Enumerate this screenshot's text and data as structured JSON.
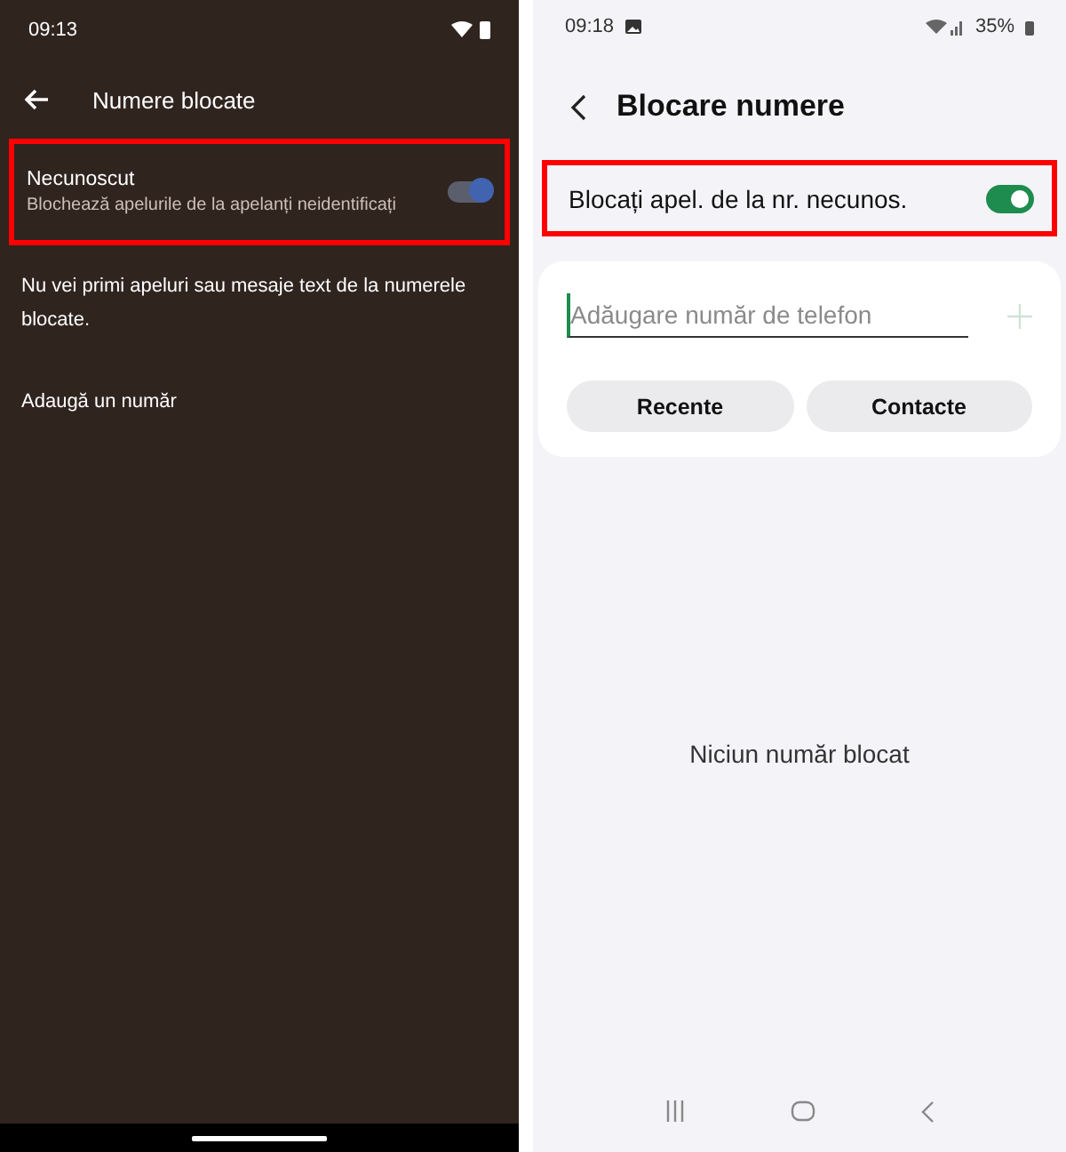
{
  "left_phone": {
    "status_bar": {
      "time": "09:13"
    },
    "title": "Numere blocate",
    "setting": {
      "title": "Necunoscut",
      "subtitle": "Blochează apelurile de la apelanți neidentificați",
      "on": true,
      "highlighted": true
    },
    "note": "Nu vei primi apeluri sau mesaje text de la numerele blocate.",
    "add_link": "Adaugă un număr"
  },
  "right_phone": {
    "status_bar": {
      "time": "09:18",
      "battery": "35%"
    },
    "title": "Blocare numere",
    "setting": {
      "label": "Blocați apel. de la nr. necunos.",
      "on": true,
      "highlighted": true
    },
    "phone_field": {
      "placeholder": "Adăugare număr de telefon"
    },
    "buttons": [
      "Recente",
      "Contacte"
    ],
    "empty_message": "Niciun număr blocat"
  }
}
